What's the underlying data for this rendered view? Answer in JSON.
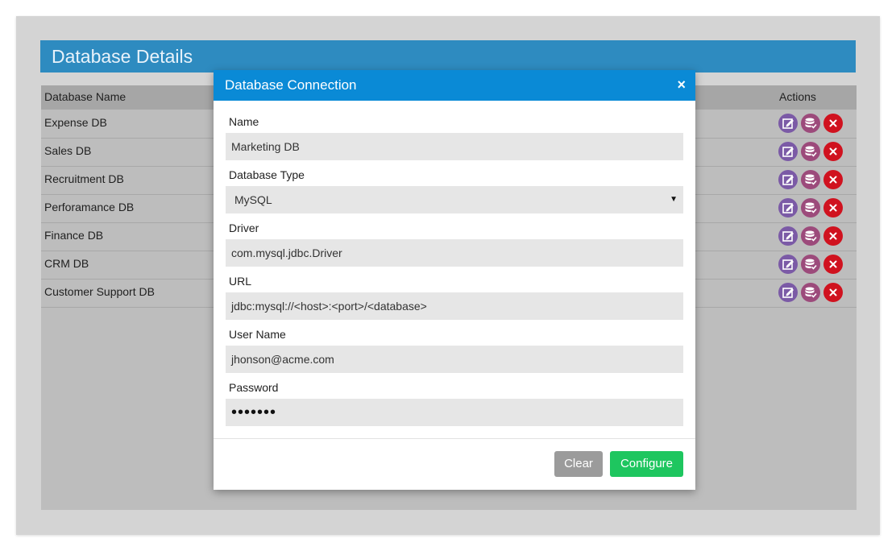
{
  "page": {
    "title": "Database Details"
  },
  "table": {
    "headers": {
      "name": "Database Name",
      "actions": "Actions"
    },
    "rows": [
      {
        "name": "Expense DB"
      },
      {
        "name": "Sales DB"
      },
      {
        "name": "Recruitment DB"
      },
      {
        "name": "Perforamance DB"
      },
      {
        "name": "Finance DB"
      },
      {
        "name": "CRM DB"
      },
      {
        "name": "Customer Support DB"
      }
    ],
    "action_icons": [
      "edit-icon",
      "database-check-icon",
      "delete-icon"
    ]
  },
  "modal": {
    "title": "Database Connection",
    "close_glyph": "×",
    "fields": {
      "name": {
        "label": "Name",
        "value": "Marketing DB"
      },
      "db_type": {
        "label": "Database Type",
        "value": "MySQL"
      },
      "driver": {
        "label": "Driver",
        "value": "com.mysql.jdbc.Driver"
      },
      "url": {
        "label": "URL",
        "value": "jdbc:mysql://<host>:<port>/<database>"
      },
      "username": {
        "label": "User Name",
        "value": "jhonson@acme.com"
      },
      "password": {
        "label": "Password",
        "value": "•••••••"
      }
    },
    "buttons": {
      "clear": "Clear",
      "configure": "Configure"
    }
  },
  "colors": {
    "header_blue": "#2e8bc0",
    "modal_header_blue": "#0a8ad6",
    "configure_green": "#1ec65f",
    "clear_gray": "#9b9b9b",
    "edit_purple": "#7b5aa6",
    "db_magenta": "#9c4a7b",
    "delete_red": "#d0121f"
  }
}
